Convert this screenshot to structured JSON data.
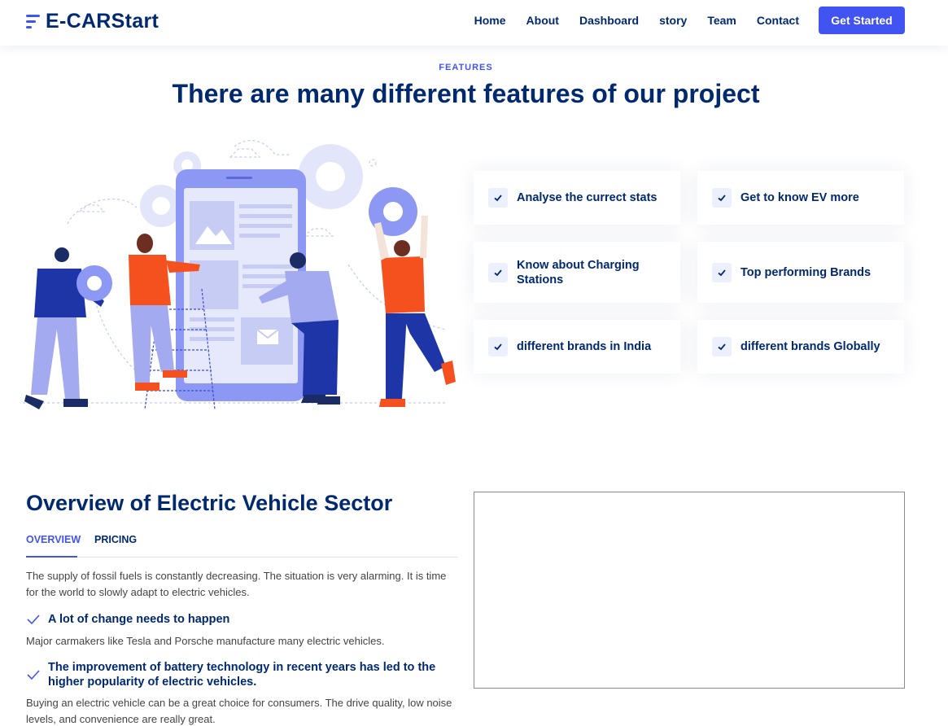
{
  "header": {
    "logo_text": "E-CARStart",
    "nav": [
      "Home",
      "About",
      "Dashboard",
      "story",
      "Team",
      "Contact"
    ],
    "cta_label": "Get Started"
  },
  "features": {
    "kicker": "FEATURES",
    "title": "There are many different features of our project",
    "items": [
      "Analyse the currect stats",
      "Get to know EV more",
      "Know about Charging Stations",
      "Top performing Brands",
      "different brands in India",
      "different brands Globally"
    ]
  },
  "overview": {
    "title": "Overview of Electric Vehicle Sector",
    "tabs": [
      "OVERVIEW",
      "PRICING"
    ],
    "intro": "The supply of fossil fuels is constantly decreasing. The situation is very alarming. It is time for the world to slowly adapt to electric vehicles.",
    "points": [
      {
        "heading": "A lot of change needs to happen",
        "text": "Major carmakers like Tesla and Porsche manufacture many electric vehicles."
      },
      {
        "heading": "The improvement of battery technology in recent years has led to the higher popularity of electric vehicles.",
        "text": "Buying an electric vehicle can be a great choice for consumers. The drive quality, low noise levels, and convenience are really great."
      }
    ]
  },
  "colors": {
    "primary": "#4154f1",
    "navy": "#012970",
    "orange": "#f4511e",
    "light_purple": "#a4aaf0"
  }
}
